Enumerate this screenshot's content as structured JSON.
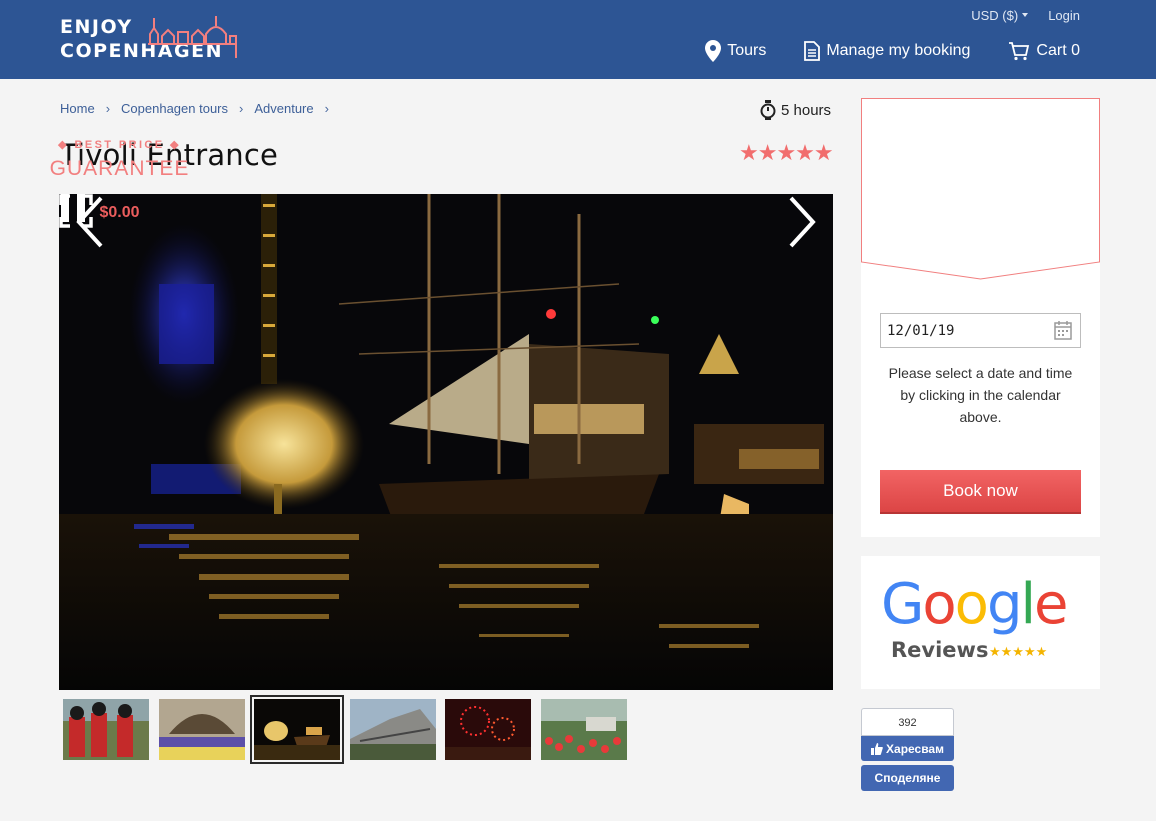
{
  "header": {
    "logo_line1": "ENJOY",
    "logo_line2": "COPENHAGEN",
    "currency": "USD ($)",
    "login": "Login",
    "nav": {
      "tours": "Tours",
      "manage": "Manage my booking",
      "cart": "Cart 0"
    }
  },
  "breadcrumb": [
    "Home",
    "Copenhagen tours",
    "Adventure"
  ],
  "duration": "5 hours",
  "title": "Tivoli Entrance",
  "rating": "★★★★★",
  "gallery": {
    "active_index": 2,
    "thumb_count": 6
  },
  "booking": {
    "best_price": "◆ BEST PRICE ◆",
    "guarantee": "GUARANTEE",
    "price": "$0.00",
    "date_value": "12/01/19",
    "help_text": "Please select a date and time by clicking in the calendar above.",
    "book_button": "Book now"
  },
  "google": {
    "word": "Google",
    "reviews": "Reviews",
    "stars": "★★★★★"
  },
  "facebook": {
    "count": "392",
    "like": "Харесвам",
    "share": "Споделяне"
  },
  "colors": {
    "header_bg": "#2d5594",
    "accent": "#f16d6d",
    "fb_blue": "#4267b2"
  }
}
